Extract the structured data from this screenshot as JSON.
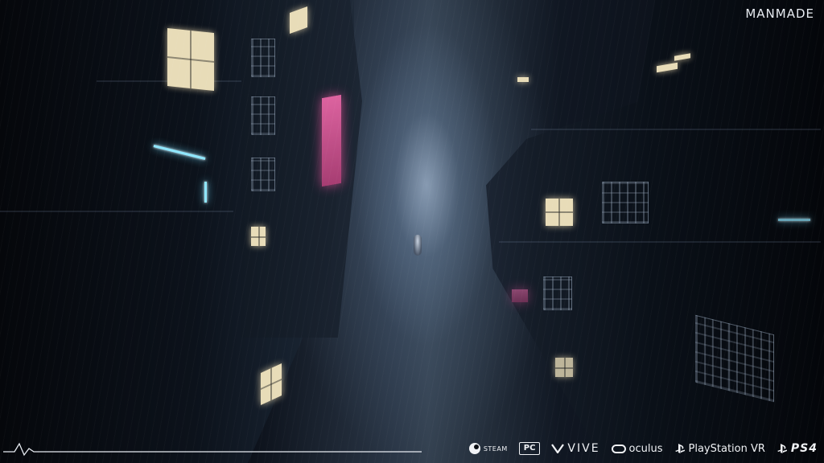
{
  "branding": {
    "studio_logo": "MANMADE"
  },
  "platforms": {
    "steam": "STEAM",
    "pc": "PC",
    "vive": "VIVE",
    "oculus": "oculus",
    "psvr": "PlayStation VR",
    "ps4": "PS4"
  },
  "icons": {
    "steam": "steam-logo-icon",
    "vive": "vive-logo-icon",
    "oculus": "oculus-logo-icon",
    "playstation": "playstation-logo-icon",
    "pulse": "heartbeat-line-icon"
  },
  "colors": {
    "text": "#f0f2f5",
    "neon_cyan": "#8fe7ff",
    "neon_pink": "#ff6fb4",
    "window_light": "#e8dcb8"
  }
}
